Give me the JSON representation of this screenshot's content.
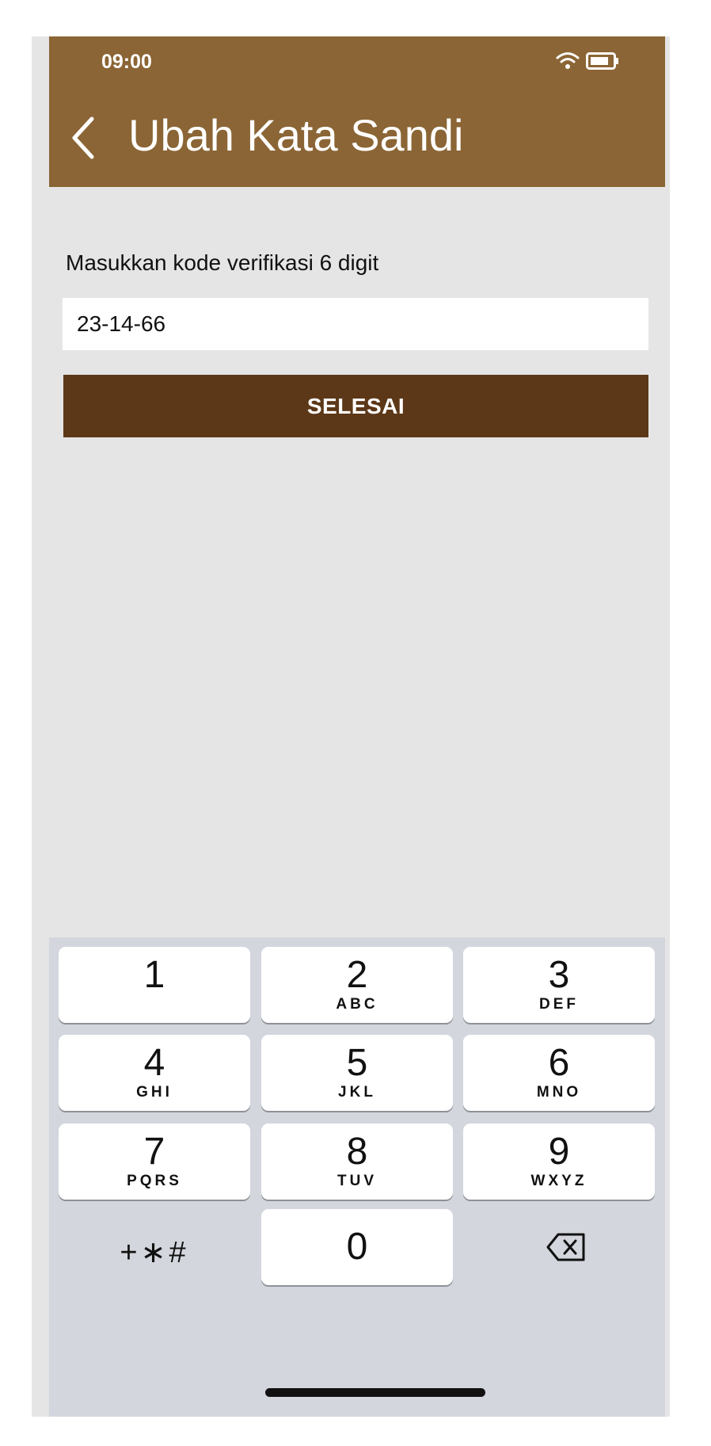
{
  "status_bar": {
    "time": "09:00",
    "wifi_icon": "wifi-icon",
    "battery_icon": "battery-icon"
  },
  "header": {
    "back_icon": "chevron-left-icon",
    "title": "Ubah Kata Sandi",
    "color": "#8b6535"
  },
  "form": {
    "label": "Masukkan kode verifikasi 6 digit",
    "code_value": "23-14-66",
    "submit_label": "SELESAI",
    "submit_color": "#5c3818"
  },
  "keypad": {
    "keys": [
      {
        "digit": "1",
        "letters": ""
      },
      {
        "digit": "2",
        "letters": "ABC"
      },
      {
        "digit": "3",
        "letters": "DEF"
      },
      {
        "digit": "4",
        "letters": "GHI"
      },
      {
        "digit": "5",
        "letters": "JKL"
      },
      {
        "digit": "6",
        "letters": "MNO"
      },
      {
        "digit": "7",
        "letters": "PQRS"
      },
      {
        "digit": "8",
        "letters": "TUV"
      },
      {
        "digit": "9",
        "letters": "WXYZ"
      },
      {
        "digit": "0",
        "letters": ""
      }
    ],
    "symbols_label": "+∗#",
    "delete_icon": "backspace-icon"
  }
}
